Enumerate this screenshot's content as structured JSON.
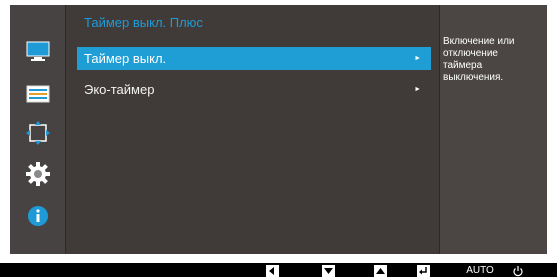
{
  "left_nav": {
    "items": [
      {
        "id": "picture",
        "icon": "monitor-icon",
        "color": "#1e9bd7"
      },
      {
        "id": "screen-size",
        "icon": "screen-adjust-icon",
        "color": "#ffffff"
      },
      {
        "id": "position",
        "icon": "arrows-icon",
        "color": "#1e9bd7"
      },
      {
        "id": "system",
        "icon": "gear-icon",
        "color": "#ffffff"
      },
      {
        "id": "info",
        "icon": "info-icon",
        "color": "#1e9bd7"
      }
    ]
  },
  "panel": {
    "title": "Таймер выкл. Плюс",
    "items": [
      {
        "label": "Таймер выкл.",
        "arrow": "►",
        "selected": true
      },
      {
        "label": "Эко-таймер",
        "arrow": "►",
        "selected": false
      }
    ]
  },
  "description": "Включение или отключение таймера выключения.",
  "footer": {
    "keys": [
      {
        "name": "left",
        "icon": "left-arrow-key-icon"
      },
      {
        "name": "down",
        "icon": "down-arrow-key-icon"
      },
      {
        "name": "up",
        "icon": "up-arrow-key-icon"
      },
      {
        "name": "enter",
        "icon": "enter-key-icon"
      },
      {
        "name": "auto",
        "label": "AUTO"
      },
      {
        "name": "power",
        "icon": "power-icon"
      }
    ]
  },
  "colors": {
    "accent": "#1f9ed6",
    "panel_bg": "#403b38",
    "osd_bg": "#4b4643"
  }
}
